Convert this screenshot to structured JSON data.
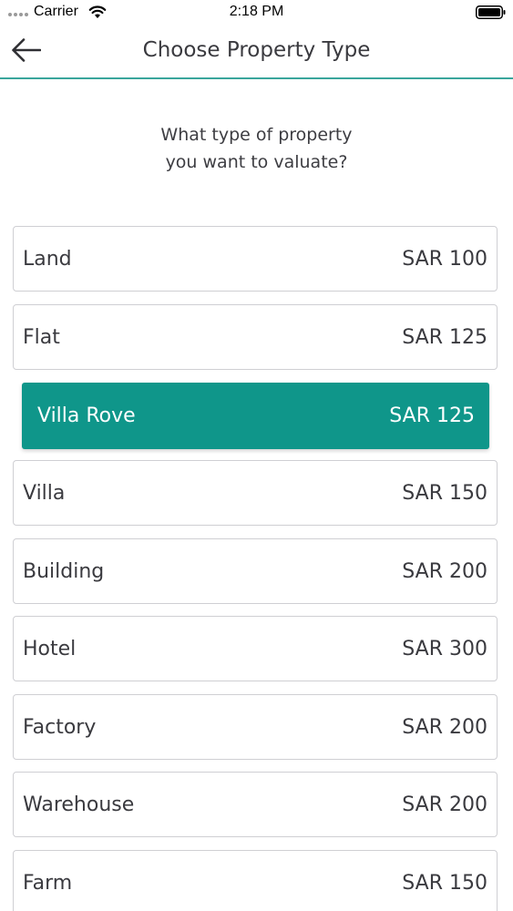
{
  "status_bar": {
    "carrier": "Carrier",
    "time": "2:18 PM"
  },
  "nav": {
    "title": "Choose Property Type",
    "back_icon": "arrow-left-icon"
  },
  "prompt": {
    "line1": "What type of property",
    "line2": "you want to valuate?"
  },
  "colors": {
    "accent": "#0f968a",
    "divider": "#3aa69c",
    "border": "#cfcfd3",
    "text": "#3a3a3f"
  },
  "property_types": [
    {
      "name": "Land",
      "price": "SAR 100",
      "selected": false
    },
    {
      "name": "Flat",
      "price": "SAR 125",
      "selected": false
    },
    {
      "name": "Villa Rove",
      "price": "SAR 125",
      "selected": true
    },
    {
      "name": "Villa",
      "price": "SAR 150",
      "selected": false
    },
    {
      "name": "Building",
      "price": "SAR 200",
      "selected": false
    },
    {
      "name": "Hotel",
      "price": "SAR 300",
      "selected": false
    },
    {
      "name": "Factory",
      "price": "SAR 200",
      "selected": false
    },
    {
      "name": "Warehouse",
      "price": "SAR 200",
      "selected": false
    },
    {
      "name": "Farm",
      "price": "SAR 150",
      "selected": false
    }
  ]
}
